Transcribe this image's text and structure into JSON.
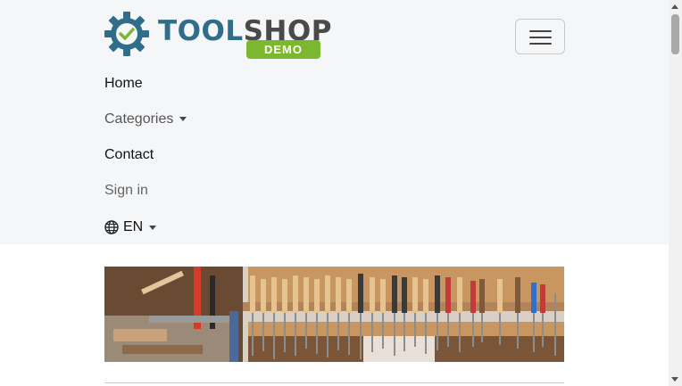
{
  "brand": {
    "word_part1": "TOOL",
    "word_part2": "SHOP",
    "badge": "DEMO",
    "colors": {
      "tool": "#2f6d8a",
      "shop": "#4a4a4a",
      "badge": "#7cb82f",
      "gear": "#2f6d8a",
      "check": "#7cb82f"
    },
    "logo_icon": "gear-check-icon"
  },
  "navbar": {
    "toggler_icon": "hamburger-menu-icon",
    "items": [
      {
        "label": "Home"
      },
      {
        "label": "Categories",
        "has_dropdown": true
      },
      {
        "label": "Contact"
      },
      {
        "label": "Sign in"
      }
    ],
    "language": {
      "label": "EN",
      "icon": "globe-icon",
      "has_dropdown": true
    }
  },
  "banner": {
    "description_icon": "tools-banner-image"
  }
}
